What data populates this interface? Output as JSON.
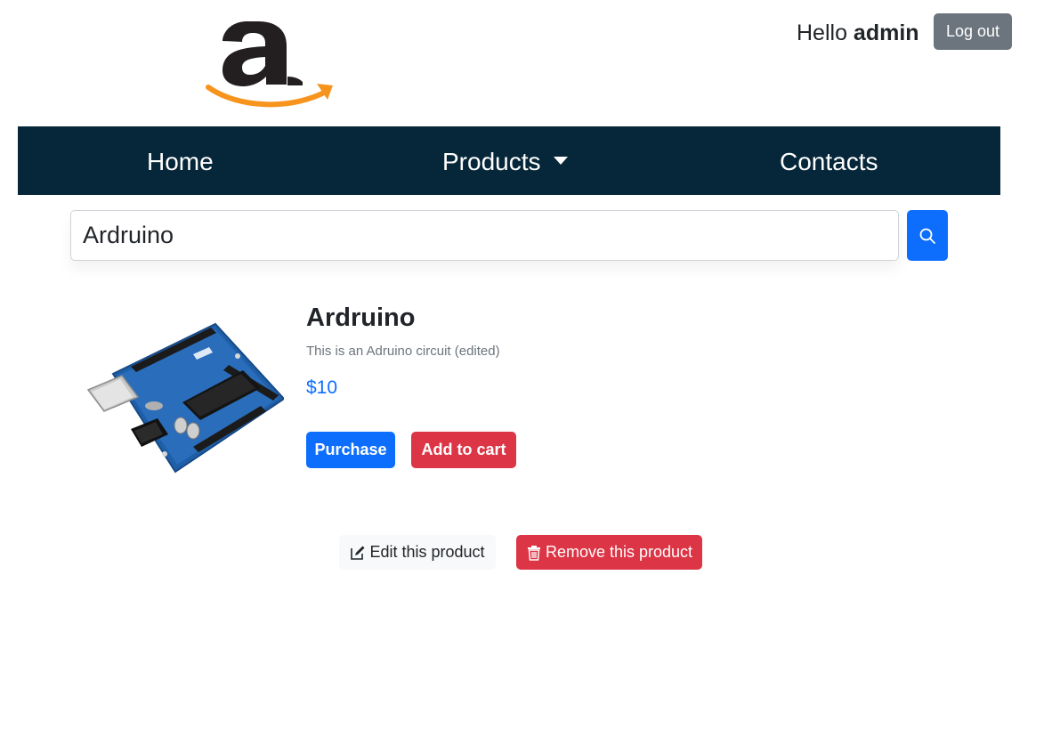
{
  "header": {
    "logo_icon": "amazon-logo",
    "greeting_prefix": "Hello ",
    "username": "admin",
    "logout_label": "Log out"
  },
  "nav": {
    "items": [
      {
        "label": "Home"
      },
      {
        "label": "Products",
        "icon": "caret-down-icon"
      },
      {
        "label": "Contacts"
      }
    ]
  },
  "search": {
    "value": "Ardruino",
    "button_icon": "search-icon"
  },
  "product": {
    "image_icon": "arduino-uno-board",
    "title": "Ardruino",
    "description": "This is an Adruino circuit (edited)",
    "price": "$10",
    "purchase_label": "Purchase",
    "add_to_cart_label": "Add to cart"
  },
  "admin_actions": {
    "edit_label": "Edit this product",
    "edit_icon": "pencil-square-icon",
    "remove_label": "Remove this product",
    "remove_icon": "trash-icon"
  },
  "colors": {
    "navbar": "#062639",
    "primary": "#0d6efd",
    "danger": "#dc3545",
    "secondary": "#6c757d",
    "light": "#f8f9fa"
  }
}
